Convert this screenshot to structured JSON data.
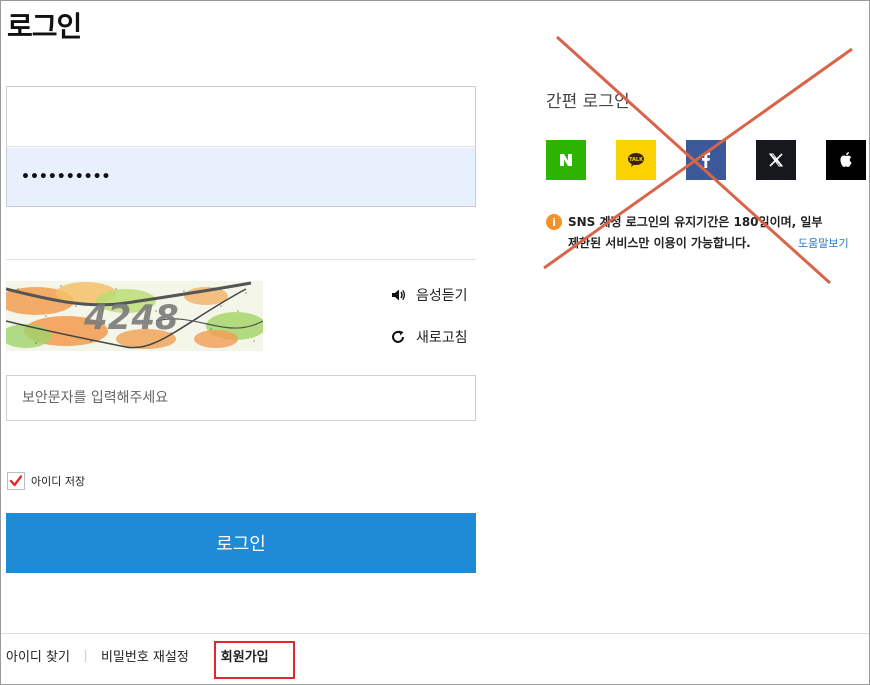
{
  "page": {
    "title": "로그인"
  },
  "form": {
    "id_value": "",
    "password_mask": "••••••••••",
    "captcha_text": "4248",
    "audio_label": "음성듣기",
    "refresh_label": "새로고침",
    "captcha_placeholder": "보안문자를 입력해주세요",
    "remember_label": "아이디 저장",
    "remember_checked": true,
    "login_button": "로그인"
  },
  "footer": {
    "find_id": "아이디 찾기",
    "reset_password": "비밀번호 재설정",
    "signup": "회원가입"
  },
  "sns": {
    "title": "간편 로그인",
    "providers": [
      {
        "name": "naver",
        "icon": "naver-icon",
        "color": "#2db400"
      },
      {
        "name": "kakao",
        "icon": "kakao-icon",
        "color": "#f9d200"
      },
      {
        "name": "facebook",
        "icon": "facebook-icon",
        "color": "#3b5998"
      },
      {
        "name": "x",
        "icon": "x-icon",
        "color": "#16181c"
      },
      {
        "name": "apple",
        "icon": "apple-icon",
        "color": "#000000"
      }
    ],
    "notice_line1": "SNS 계정 로그인의 유지기간은 180일이며, 일부",
    "notice_line2": "제한된 서비스만 이용이 가능합니다.",
    "help_link": "도움말보기",
    "crossed_out": true
  },
  "colors": {
    "primary": "#1f8bd6",
    "highlight": "#e0282e",
    "cross": "#d9644a",
    "checkbox": "#e0282e"
  }
}
